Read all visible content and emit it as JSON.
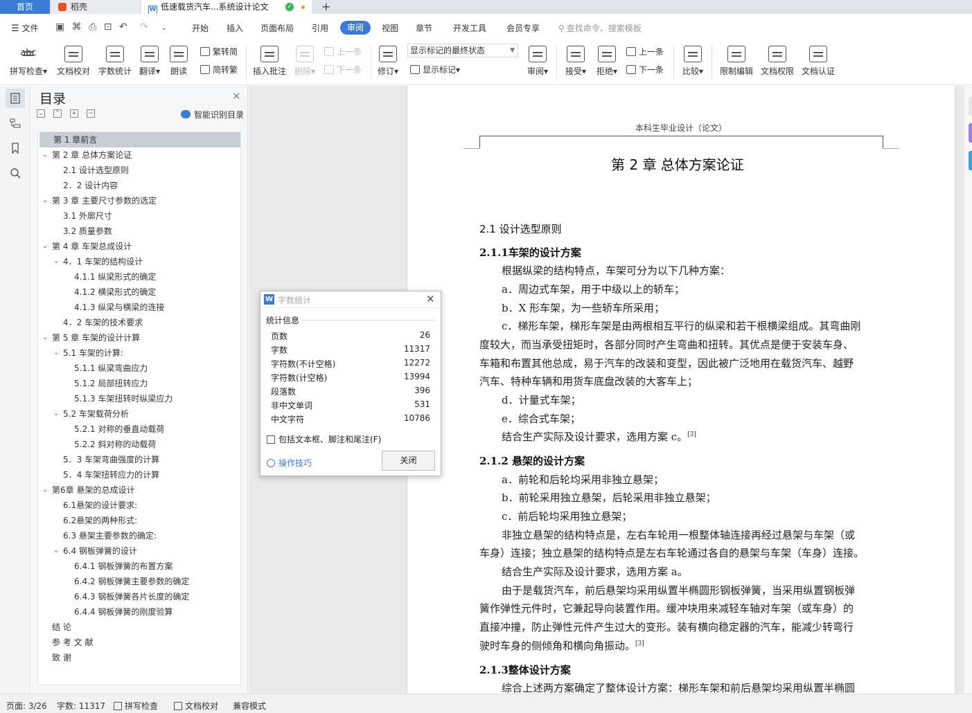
{
  "titlebar": {
    "home_tab": "首页",
    "daoke_tab": "稻壳",
    "doc_tab": "低速载货汽车...系统设计论文",
    "new_tab_icon": "plus-icon"
  },
  "menubar": {
    "items": [
      "文件",
      "开始",
      "插入",
      "页面布局",
      "引用",
      "审阅",
      "视图",
      "章节",
      "开发工具",
      "会员专享"
    ],
    "active": "审阅",
    "search_placeholder": "查找命令、搜索模板"
  },
  "ribbon": {
    "spellcheck": "拼写检查",
    "proofread": "文档校对",
    "word_count": "字数统计",
    "translate": "翻译",
    "read_aloud": "朗读",
    "trad_to_simp": "繁转简",
    "simp_to_trad": "简转繁",
    "insert_comment": "插入批注",
    "delete": "删除",
    "prev": "上一条",
    "next": "下一条",
    "revise": "修订",
    "markup_state": "显示标记的最终状态",
    "show_markup": "显示标记",
    "review": "审阅",
    "accept": "接受",
    "reject": "拒绝",
    "prev2": "上一条",
    "next2": "下一条",
    "compare": "比较",
    "restrict_edit": "限制编辑",
    "doc_permission": "文档权限",
    "doc_auth": "文档认证"
  },
  "toc": {
    "title": "目录",
    "smart": "智能识别目录",
    "items": [
      {
        "text": "第 1 章前言",
        "level": 1,
        "selected": true
      },
      {
        "text": "第 2 章  总体方案论证",
        "level": 1,
        "caret": true
      },
      {
        "text": "2.1  设计选型原则",
        "level": 2
      },
      {
        "text": "2．2  设计内容",
        "level": 2
      },
      {
        "text": "第 3 章  主要尺寸参数的选定",
        "level": 1,
        "caret": true
      },
      {
        "text": "3.1  外廓尺寸",
        "level": 2
      },
      {
        "text": "3.2  质量参数",
        "level": 2
      },
      {
        "text": "第 4 章  车架总成设计",
        "level": 1,
        "caret": true
      },
      {
        "text": "4．1  车架的结构设计",
        "level": 2,
        "caret": true
      },
      {
        "text": "4.1.1  纵梁形式的确定",
        "level": 3
      },
      {
        "text": "4.1.2  横梁形式的确定",
        "level": 3
      },
      {
        "text": "4.1.3  纵梁与横梁的连接",
        "level": 3
      },
      {
        "text": "4．2  车架的技术要求",
        "level": 2
      },
      {
        "text": "第 5 章  车架的设计计算",
        "level": 1,
        "caret": true
      },
      {
        "text": "5.1  车架的计算:",
        "level": 2,
        "caret": true
      },
      {
        "text": "5.1.1  纵梁弯曲应力",
        "level": 3
      },
      {
        "text": "5.1.2 局部扭转应力",
        "level": 3
      },
      {
        "text": "5.1.3  车架扭转时纵梁应力",
        "level": 3
      },
      {
        "text": "5.2  车架载荷分析",
        "level": 2,
        "caret": true
      },
      {
        "text": "5.2.1  对称的垂直动载荷",
        "level": 3
      },
      {
        "text": "5.2.2  斜对称的动载荷",
        "level": 3
      },
      {
        "text": "5．3  车架弯曲强度的计算",
        "level": 2
      },
      {
        "text": "5．4  车架扭转应力的计算",
        "level": 2
      },
      {
        "text": "第6章  悬架的总成设计",
        "level": 1,
        "caret": true
      },
      {
        "text": "6.1悬架的设计要求:",
        "level": 2
      },
      {
        "text": "6.2悬架的两种形式:",
        "level": 2
      },
      {
        "text": "6.3 悬架主要参数的确定:",
        "level": 2
      },
      {
        "text": "6.4 钢板弹簧的设计",
        "level": 2,
        "caret": true
      },
      {
        "text": "6.4.1 钢板弹簧的布置方案",
        "level": 3
      },
      {
        "text": "6.4.2  钢板弹簧主要参数的确定",
        "level": 3
      },
      {
        "text": "6.4.3  钢板弹簧各片长度的确定",
        "level": 3
      },
      {
        "text": "6.4.4  钢板弹簧的刚度验算",
        "level": 3
      },
      {
        "text": "结  论",
        "level": 1
      },
      {
        "text": "参 考 文 献",
        "level": 1
      },
      {
        "text": "致      谢",
        "level": 1
      }
    ]
  },
  "document": {
    "header": "本科生毕业设计（论文）",
    "chapter_title": "第 2 章  总体方案论证",
    "lines": {
      "h21": "2.1  设计选型原则",
      "h211": "2.1.1车架的设计方案",
      "p1": "根据纵梁的结构特点，车架可分为以下几种方案：",
      "p2": "a．周边式车架，用于中级以上的轿车；",
      "p3": "b．X 形车架，为一些轿车所采用；",
      "p4a": "c．梯形车架，梯形车架是由两根相互平行的纵梁和若干根横梁组成。其弯曲刚",
      "p4b": "度较大，而当承受扭矩时，各部分同时产生弯曲和扭转。其优点是便于安装车身、",
      "p4c": "车箱和布置其他总成，易于汽车的改装和变型，因此被广泛地用在载货汽车、越野",
      "p4d": "汽车、特种车辆和用货车底盘改装的大客车上；",
      "p5": "d．计量式车架；",
      "p6": "e．综合式车架；",
      "p7": "结合生产实际及设计要求，选用方案 c。",
      "ref": "[3]",
      "h212": "2.1.2 悬架的设计方案",
      "q1": "a．前轮和后轮均采用非独立悬架；",
      "q2": "b．前轮采用独立悬架，后轮采用非独立悬架；",
      "q3": "c．前后轮均采用独立悬架；",
      "q4a": "非独立悬架的结构特点是，左右车轮用一根整体轴连接再经过悬架与车架（或",
      "q4b": "车身）连接；独立悬架的结构特点是左右车轮通过各自的悬架与车架（车身）连接。",
      "q5": "结合生产实际及设计要求，选用方案 a。",
      "q6a": "由于是载货汽车，前后悬架均采用纵置半椭圆形钢板弹簧，当采用纵置钢板弹",
      "q6b": "簧作弹性元件时，它兼起导向装置作用。缓冲块用来减轻车轴对车架（或车身）的",
      "q6c": "直接冲撞，防止弹性元件产生过大的变形。装有横向稳定器的汽车，能减少转弯行",
      "q6d": "驶时车身的侧倾角和横向角振动。",
      "ref2": "[3]",
      "h213": "2.1.3整体设计方案",
      "r1": "综合上述两方案确定了整体设计方案：梯形车架和前后悬架均采用纵置半椭圆"
    }
  },
  "dialog": {
    "title": "字数统计",
    "section": "统计信息",
    "stats": [
      {
        "label": "页数",
        "value": "26"
      },
      {
        "label": "字数",
        "value": "11317"
      },
      {
        "label": "字符数(不计空格)",
        "value": "12272"
      },
      {
        "label": "字符数(计空格)",
        "value": "13994"
      },
      {
        "label": "段落数",
        "value": "396"
      },
      {
        "label": "非中文单词",
        "value": "531"
      },
      {
        "label": "中文字符",
        "value": "10786"
      }
    ],
    "checkbox": "包括文本框、脚注和尾注(F)",
    "tips": "操作技巧",
    "close": "关闭"
  },
  "statusbar": {
    "page": "页面: 3/26",
    "words": "字数: 11317",
    "spellcheck": "拼写检查",
    "proofread": "文档校对",
    "compat": "兼容模式"
  },
  "colors": {
    "accent": "#3b7bd6",
    "toc_selected": "#c9ced6"
  }
}
